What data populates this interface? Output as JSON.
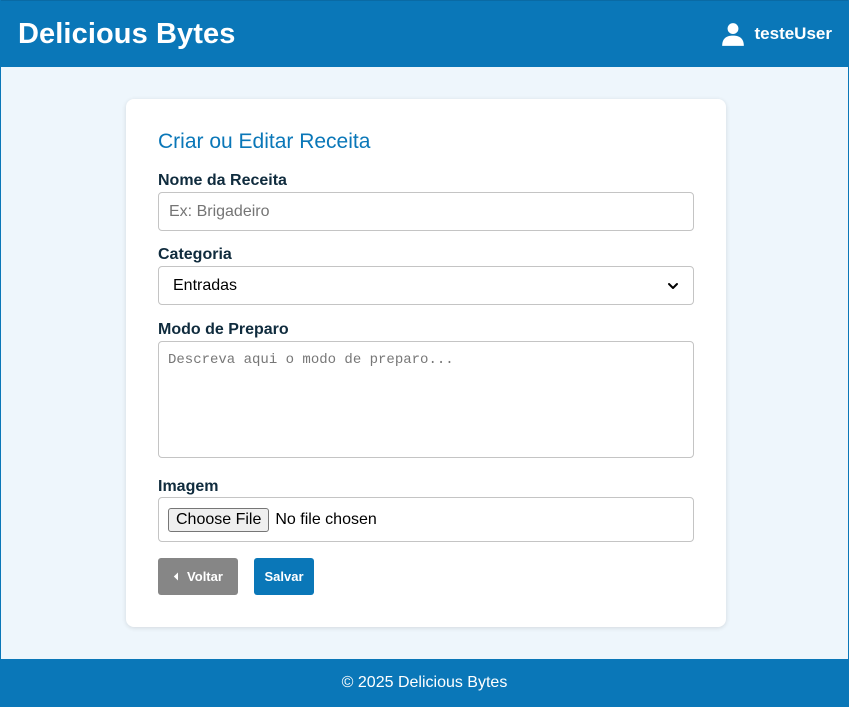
{
  "header": {
    "brand": "Delicious Bytes",
    "username": "testeUser",
    "user_icon": "user-icon"
  },
  "form": {
    "title": "Criar ou Editar Receita",
    "name_label": "Nome da Receita",
    "name_placeholder": "Ex: Brigadeiro",
    "name_value": "",
    "category_label": "Categoria",
    "category_selected": "Entradas",
    "method_label": "Modo de Preparo",
    "method_placeholder": "Descreva aqui o modo de preparo...",
    "image_label": "Imagem",
    "file_button": "Choose File",
    "file_status": "No file chosen",
    "back_label": "Voltar",
    "save_label": "Salvar"
  },
  "footer": {
    "text": "© 2025 Delicious Bytes"
  },
  "colors": {
    "primary": "#0a77b8",
    "secondary_button": "#868686",
    "page_background": "#eef6fc"
  }
}
